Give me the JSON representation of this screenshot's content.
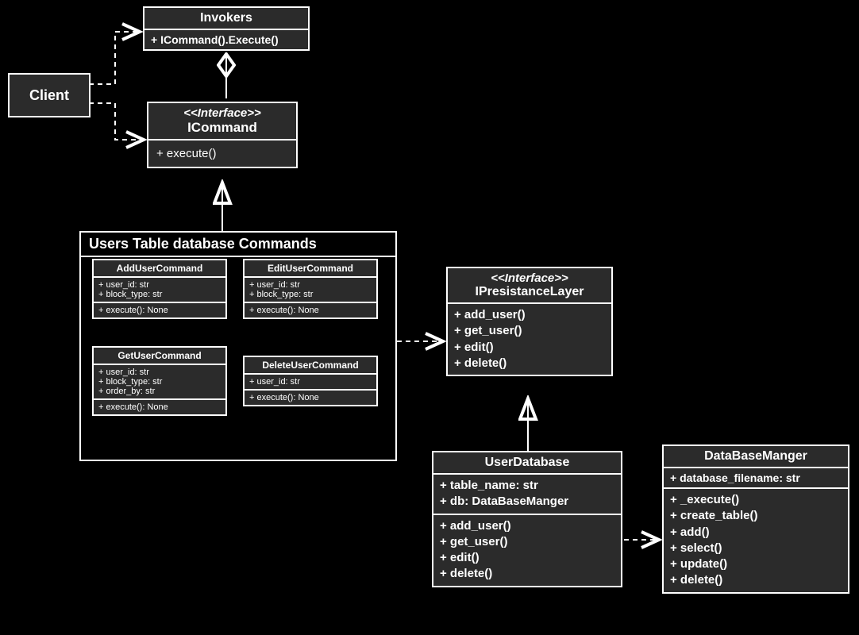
{
  "client": {
    "label": "Client"
  },
  "invokers": {
    "title": "Invokers",
    "method": "+ ICommand().Execute()"
  },
  "icommand": {
    "stereo": "<<Interface>>",
    "name": "ICommand",
    "method": "+ execute()"
  },
  "package": {
    "title": "Users Table database Commands",
    "addUser": {
      "title": "AddUserCommand",
      "attrs": "+ user_id: str\n+ block_type: str",
      "method": "+ execute(): None"
    },
    "editUser": {
      "title": "EditUserCommand",
      "attrs": "+ user_id: str\n+ block_type: str",
      "method": "+ execute(): None"
    },
    "getUser": {
      "title": "GetUserCommand",
      "attrs": "+ user_id: str\n+ block_type: str\n+ order_by: str",
      "method": "+ execute(): None"
    },
    "deleteUser": {
      "title": "DeleteUserCommand",
      "attrs": "+ user_id: str",
      "method": "+ execute(): None"
    }
  },
  "ipresistance": {
    "stereo": "<<Interface>>",
    "name": "IPresistanceLayer",
    "methods": "+ add_user()\n+ get_user()\n+ edit()\n+ delete()"
  },
  "userdb": {
    "title": "UserDatabase",
    "attrs": "+ table_name: str\n+ db: DataBaseManger",
    "methods": "+ add_user()\n+ get_user()\n+ edit()\n+ delete()"
  },
  "dbmanager": {
    "title": "DataBaseManger",
    "attrs": "+ database_filename: str",
    "methods": "+ _execute()\n+ create_table()\n+ add()\n+ select()\n+ update()\n+ delete()"
  }
}
